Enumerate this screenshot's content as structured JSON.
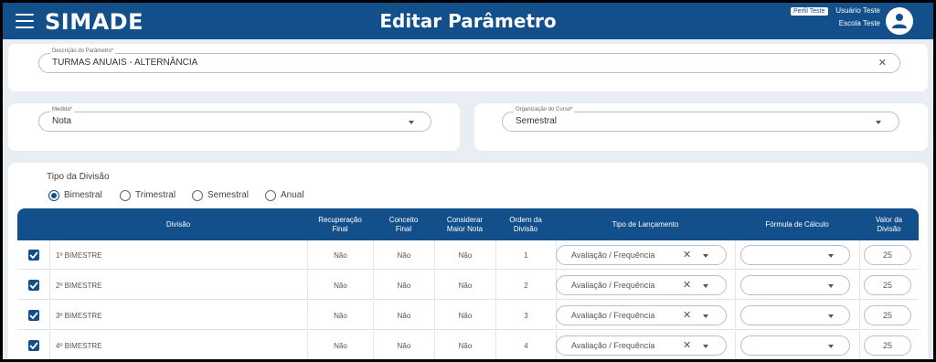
{
  "header": {
    "app_name": "SIMADE",
    "page_title": "Editar Parâmetro",
    "profile_badge": "Perfil Teste",
    "user_name": "Usuário Teste",
    "school_name": "Escola Teste",
    "bar_color": "#134f8a"
  },
  "form": {
    "description": {
      "label": "Descrição do Parâmetro*",
      "value": "TURMAS ANUAIS - ALTERNÂNCIA"
    },
    "measure": {
      "label": "Medida*",
      "value": "Nota"
    },
    "course_org": {
      "label": "Organização do Curso*",
      "value": "Semestral"
    }
  },
  "division_type": {
    "label": "Tipo da Divisão",
    "options": [
      "Bimestral",
      "Trimestral",
      "Semestral",
      "Anual"
    ],
    "selected": "Bimestral"
  },
  "table": {
    "headers": {
      "division": "Divisão",
      "recovery_1": "Recuperação",
      "recovery_2": "Final",
      "concept_1": "Conceito",
      "concept_2": "Final",
      "consider_1": "Considerar",
      "consider_2": "Maior Nota",
      "order_1": "Ordem da",
      "order_2": "Divisão",
      "launch_type": "Tipo de Lançamento",
      "formula": "Fórmula de Cálculo",
      "value_1": "Valor da",
      "value_2": "Divisão"
    },
    "rows": [
      {
        "checked": true,
        "division": "1º BIMESTRE",
        "recovery": "Não",
        "concept": "Não",
        "consider": "Não",
        "order": "1",
        "launch_type": "Avaliação / Frequência",
        "formula": "",
        "value": "25"
      },
      {
        "checked": true,
        "division": "2º BIMESTRE",
        "recovery": "Não",
        "concept": "Não",
        "consider": "Não",
        "order": "2",
        "launch_type": "Avaliação / Frequência",
        "formula": "",
        "value": "25"
      },
      {
        "checked": true,
        "division": "3º BIMESTRE",
        "recovery": "Não",
        "concept": "Não",
        "consider": "Não",
        "order": "3",
        "launch_type": "Avaliação / Frequência",
        "formula": "",
        "value": "25"
      },
      {
        "checked": true,
        "division": "4º BIMESTRE",
        "recovery": "Não",
        "concept": "Não",
        "consider": "Não",
        "order": "4",
        "launch_type": "Avaliação / Frequência",
        "formula": "",
        "value": "25"
      }
    ]
  },
  "icons": {
    "menu": "menu-icon",
    "clear": "close-icon",
    "dropdown": "chevron-down-icon",
    "avatar": "user-icon",
    "check": "check-icon"
  }
}
